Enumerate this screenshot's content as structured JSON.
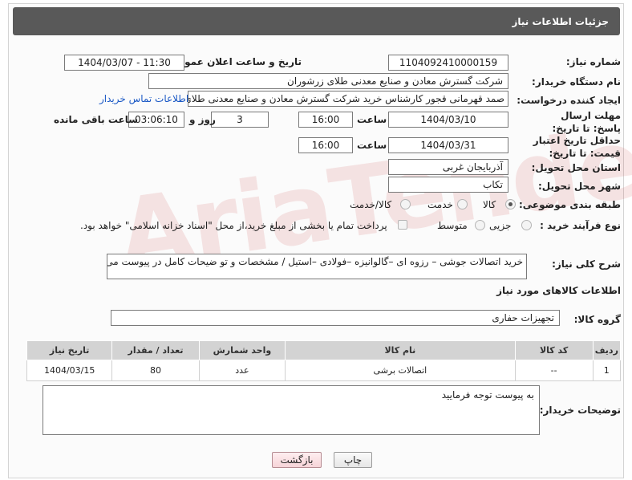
{
  "header": {
    "title": "جزئیات اطلاعات نیاز"
  },
  "fields": {
    "need_number_label": "شماره نیاز:",
    "need_number": "1104092410000159",
    "announce_label": "تاریخ و ساعت اعلان عمومی:",
    "announce_value": "1404/03/07 - 11:30",
    "buyer_org_label": "نام دستگاه خریدار:",
    "buyer_org": "شرکت گسترش معادن و صنایع معدنی طلای زرشوران",
    "requester_label": "ایجاد کننده درخواست:",
    "requester": "صمد قهرمانی قجور کارشناس خرید شرکت گسترش معادن و صنایع معدنی طلای",
    "contact_link": "اطلاعات تماس خریدار",
    "reply_deadline_label": "مهلت ارسال پاسخ: تا تاریخ:",
    "reply_date": "1404/03/10",
    "time_label": "ساعت",
    "reply_time": "16:00",
    "day_and_label": "روز و",
    "days_left": "3",
    "remaining_time": "03:06:10",
    "remaining_label": "ساعت باقی مانده",
    "price_validity_label": "حداقل تاریخ اعتبار قیمت: تا تاریخ:",
    "validity_date": "1404/03/31",
    "validity_time": "16:00",
    "province_label": "استان محل تحویل:",
    "province": "آذربایجان غربی",
    "city_label": "شهر محل تحویل:",
    "city": "تکاب",
    "category_label": "طبقه بندی موضوعی:",
    "category_options": [
      "کالا",
      "خدمت",
      "کالا/خدمت"
    ],
    "process_label": "نوع فرآیند خرید :",
    "process_options": [
      "جزیی",
      "متوسط"
    ],
    "payment_note": "پرداخت تمام یا بخشی از مبلغ خرید،از محل \"اسناد خزانه اسلامی\" خواهد بود.",
    "description_label": "شرح کلی نیاز:",
    "description": "خرید اتصالات جوشی – رزوه ای –گالوانیزه –فولادی –استیل / مشخصات و تو ضیحات کامل در پیوست می باشد",
    "goods_info_title": "اطلاعات کالاهای مورد نیاز",
    "goods_group_label": "گروه کالا:",
    "goods_group": "تجهیزات حفاری",
    "buyer_notes_label": "توضیحات خریدار:",
    "buyer_notes": "به پیوست توجه فرمایید"
  },
  "table": {
    "headers": [
      "ردیف",
      "کد کالا",
      "نام کالا",
      "واحد شمارش",
      "تعداد / مقدار",
      "تاریخ نیاز"
    ],
    "rows": [
      [
        "1",
        "--",
        "اتصالات برشی",
        "عدد",
        "80",
        "1404/03/15"
      ]
    ]
  },
  "buttons": {
    "print": "چاپ",
    "back": "بازگشت"
  },
  "watermark": "AriaTender.net",
  "colors": {
    "header_bg": "#595959",
    "link": "#1a58c5",
    "back_button": "#f6d4d8"
  }
}
